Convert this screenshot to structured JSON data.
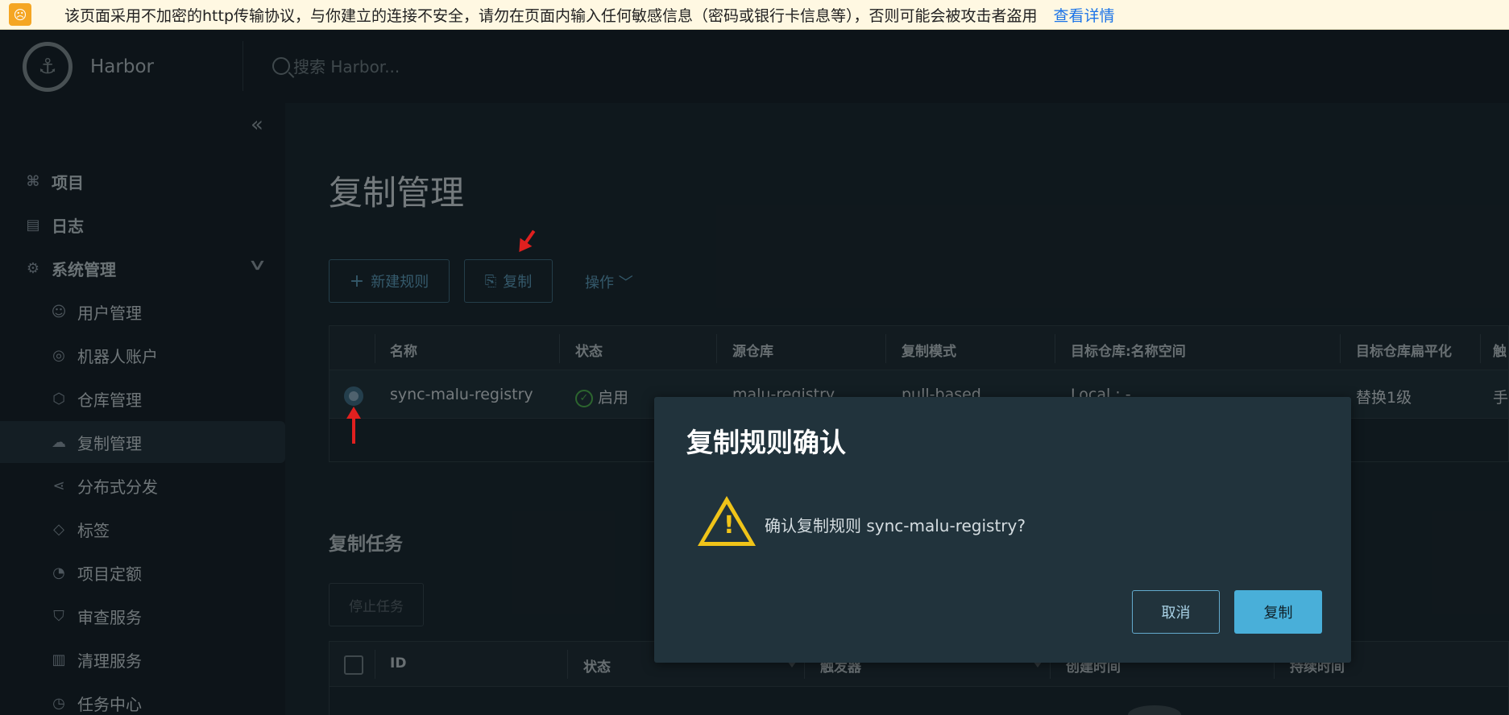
{
  "browser_warning": {
    "text": "该页面采用不加密的http传输协议，与你建立的连接不安全，请勿在页面内输入任何敏感信息（密码或银行卡信息等），否则可能会被攻击者盗用",
    "link": "查看详情"
  },
  "header": {
    "brand": "Harbor",
    "search_placeholder": "搜索 Harbor..."
  },
  "sidebar": {
    "items": [
      {
        "label": "项目",
        "icon": "projects-icon"
      },
      {
        "label": "日志",
        "icon": "logs-icon"
      },
      {
        "label": "系统管理",
        "icon": "admin-icon"
      },
      {
        "label": "用户管理",
        "icon": "users-icon"
      },
      {
        "label": "机器人账户",
        "icon": "robot-icon"
      },
      {
        "label": "仓库管理",
        "icon": "registry-icon"
      },
      {
        "label": "复制管理",
        "icon": "replication-icon"
      },
      {
        "label": "分布式分发",
        "icon": "distribution-icon"
      },
      {
        "label": "标签",
        "icon": "tag-icon"
      },
      {
        "label": "项目定额",
        "icon": "quota-icon"
      },
      {
        "label": "审查服务",
        "icon": "shield-icon"
      },
      {
        "label": "清理服务",
        "icon": "trash-icon"
      },
      {
        "label": "任务中心",
        "icon": "gauge-icon"
      }
    ]
  },
  "main": {
    "title": "复制管理",
    "toolbar": {
      "new_rule": "新建规则",
      "copy": "复制",
      "actions": "操作"
    },
    "rules_table": {
      "columns": [
        "名称",
        "状态",
        "源仓库",
        "复制模式",
        "目标仓库:名称空间",
        "目标仓库扁平化",
        "触"
      ],
      "rows": [
        {
          "name": "sync-malu-registry",
          "status": "启用",
          "source": "malu-registry",
          "mode": "pull-based",
          "target": "Local : -",
          "flatten": "替换1级",
          "trigger": "手"
        }
      ]
    },
    "tasks": {
      "title": "复制任务",
      "stop_button": "停止任务",
      "columns": [
        "ID",
        "状态",
        "触发器",
        "创建时间",
        "持续时间"
      ]
    }
  },
  "modal": {
    "title": "复制规则确认",
    "message": "确认复制规则 sync-malu-registry?",
    "cancel": "取消",
    "confirm": "复制"
  }
}
